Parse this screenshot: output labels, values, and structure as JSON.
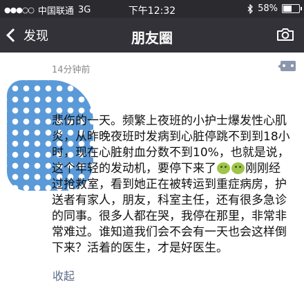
{
  "status_bar": {
    "carrier": "中国联通",
    "network": "3G",
    "time": "下午12:32",
    "battery_percent": "58%",
    "battery_level": 0.58,
    "icons": [
      "signal-dots-icon",
      "bluetooth-icon",
      "battery-icon"
    ]
  },
  "nav": {
    "back_label": "发现",
    "title": "朋友圈",
    "camera_icon": "camera-icon"
  },
  "post": {
    "timestamp": "14分钟前",
    "text_before_emoji": "悲伤的一天。频繁上夜班的小护士爆发性心肌炎，从昨晚夜班时发病到心脏停跳不到到18小时，现在心脏射血分数不到10%，也就是说，这个年轻的发动机，要停下来了",
    "emoji_count": 2,
    "text_after_emoji": "刚刚经过抢救室，看到她正在被转运到重症病房，护送者有家人，朋友，科室主任，还有很多急诊的同事。很多人都在哭，我停在那里，非常非常难过。谁知道我们会不会有一天也会这样倒下来？活着的医生，才是好医生。",
    "collapse_label": "收起"
  },
  "colors": {
    "status_bar_bg": "#2b2a2f",
    "nav_bg": "#333238",
    "link_color": "#5c6b8a",
    "more_button_bg": "#8c96ad"
  }
}
